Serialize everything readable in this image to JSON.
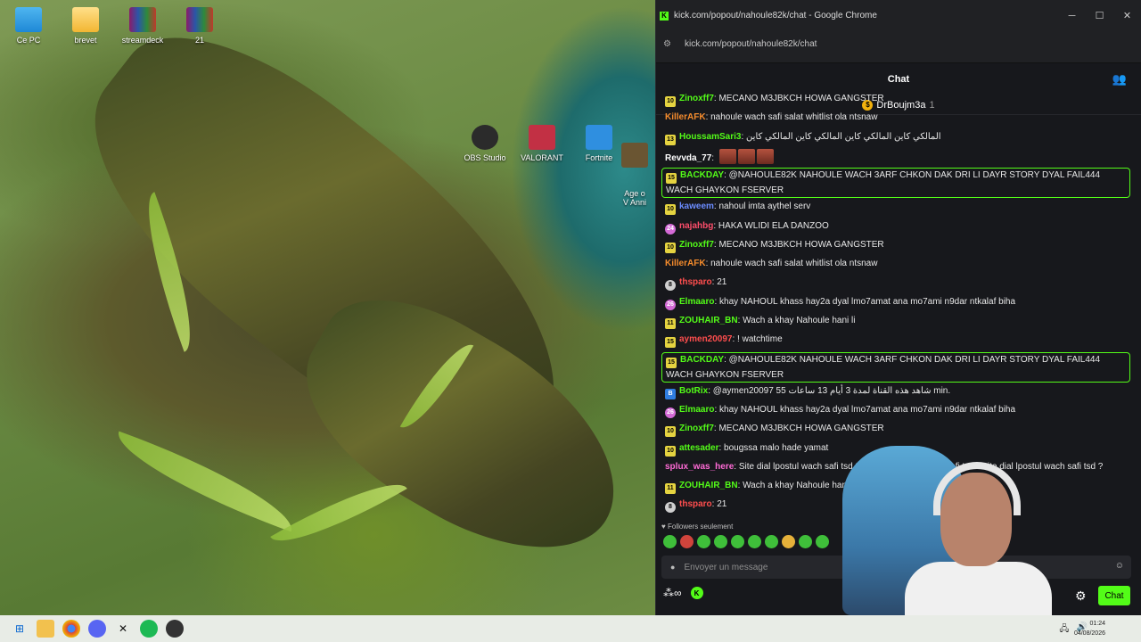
{
  "desktop": {
    "icons": [
      {
        "label": "Ce PC"
      },
      {
        "label": "brevet"
      },
      {
        "label": "streamdeck"
      },
      {
        "label": "21"
      },
      {
        "label": "OBS Studio"
      },
      {
        "label": "VALORANT"
      },
      {
        "label": "Fortnite"
      },
      {
        "label": "Age o\nV Anni"
      }
    ]
  },
  "window": {
    "title": "kick.com/popout/nahoule82k/chat - Google Chrome",
    "url": "kick.com/popout/nahoule82k/chat",
    "minimize": "─",
    "maximize": "☐",
    "close": "✕"
  },
  "chat": {
    "header": "Chat",
    "pinned_user": "DrBoujm3a",
    "pinned_count": "1",
    "messages": [
      {
        "badge": "10",
        "user": "Zinoxff7",
        "color": "#53fc18",
        "text": ": MECANO M3JBKCH HOWA GANGSTER",
        "hl": false
      },
      {
        "badge": "",
        "user": "KillerAFK",
        "color": "#f58b2c",
        "text": ": nahoule wach safi salat whitlist ola ntsnaw",
        "hl": false
      },
      {
        "badge": "13",
        "user": "HoussamSari3",
        "color": "#53fc18",
        "text": ": المالكي كاين المالكي كاين المالكي كاين المالكي كاين",
        "hl": false
      },
      {
        "badge": "",
        "user": "Revvda_77",
        "color": "#ffffff",
        "text": ":",
        "hl": false,
        "emotes": 3
      },
      {
        "badge": "15",
        "user": "BACKDAY",
        "color": "#53fc18",
        "text": ": @NAHOULE82K NAHOULE WACH 3ARF CHKON DAK DRI LI DAYR STORY DYAL FAIL444 WACH GHAYKON FSERVER",
        "hl": true
      },
      {
        "badge": "10",
        "user": "kaweem",
        "color": "#6b8cff",
        "text": ": nahoul imta aythel serv",
        "hl": false
      },
      {
        "badge": "24",
        "user": "najahbg",
        "color": "#ff4e6b",
        "text": ": HAKA WLIDI ELA DANZOO",
        "hl": false
      },
      {
        "badge": "10",
        "user": "Zinoxff7",
        "color": "#53fc18",
        "text": ": MECANO M3JBKCH HOWA GANGSTER",
        "hl": false
      },
      {
        "badge": "",
        "user": "KillerAFK",
        "color": "#f58b2c",
        "text": ": nahoule wach safi salat whitlist ola ntsnaw",
        "hl": false
      },
      {
        "badge": "8",
        "user": "thsparo",
        "color": "#ff4e4e",
        "text": ": 21",
        "hl": false
      },
      {
        "badge": "26",
        "user": "Elmaaro",
        "color": "#53fc18",
        "text": ": khay NAHOUL khass hay2a dyal lmo7amat ana mo7ami n9dar ntkalaf biha",
        "hl": false
      },
      {
        "badge": "11",
        "user": "ZOUHAIR_BN",
        "color": "#53fc18",
        "text": ": Wach a khay Nahoule hani li",
        "hl": false
      },
      {
        "badge": "15",
        "user": "aymen20097",
        "color": "#ff4e4e",
        "text": ": ! watchtime",
        "hl": false
      },
      {
        "badge": "15",
        "user": "BACKDAY",
        "color": "#53fc18",
        "text": ": @NAHOULE82K NAHOULE WACH 3ARF CHKON DAK DRI LI DAYR STORY DYAL FAIL444 WACH GHAYKON FSERVER",
        "hl": true
      },
      {
        "badge": "B",
        "user": "BotRix",
        "color": "#53fc18",
        "text": ": @aymen20097 شاهد هذه القناة لمدة 3 أيام 13 ساعات 55 min.",
        "hl": false
      },
      {
        "badge": "26",
        "user": "Elmaaro",
        "color": "#53fc18",
        "text": ": khay NAHOUL khass hay2a dyal lmo7amat ana mo7ami n9dar ntkalaf biha",
        "hl": false
      },
      {
        "badge": "10",
        "user": "Zinoxff7",
        "color": "#53fc18",
        "text": ": MECANO M3JBKCH HOWA GANGSTER",
        "hl": false
      },
      {
        "badge": "10",
        "user": "attesader",
        "color": "#53fc18",
        "text": ": bougssa malo hade yamat",
        "hl": false
      },
      {
        "badge": "",
        "user": "splux_was_here",
        "color": "#ff6bd6",
        "text": ": Site dial lpostul wach safi tsd ?Site dial lpostul wach safi tsd ?Site dial lpostul wach safi tsd ?",
        "hl": false
      },
      {
        "badge": "11",
        "user": "ZOUHAIR_BN",
        "color": "#53fc18",
        "text": ": Wach a khay Nahoule hani li",
        "hl": false
      },
      {
        "badge": "8",
        "user": "thsparo",
        "color": "#ff4e4e",
        "text": ": 21",
        "hl": false
      }
    ],
    "followers_only": "Followers seulement",
    "input_placeholder": "Envoyer un message",
    "send_label": "Chat"
  },
  "taskbar": {
    "time": "01:24",
    "date": "04/08/2026"
  }
}
